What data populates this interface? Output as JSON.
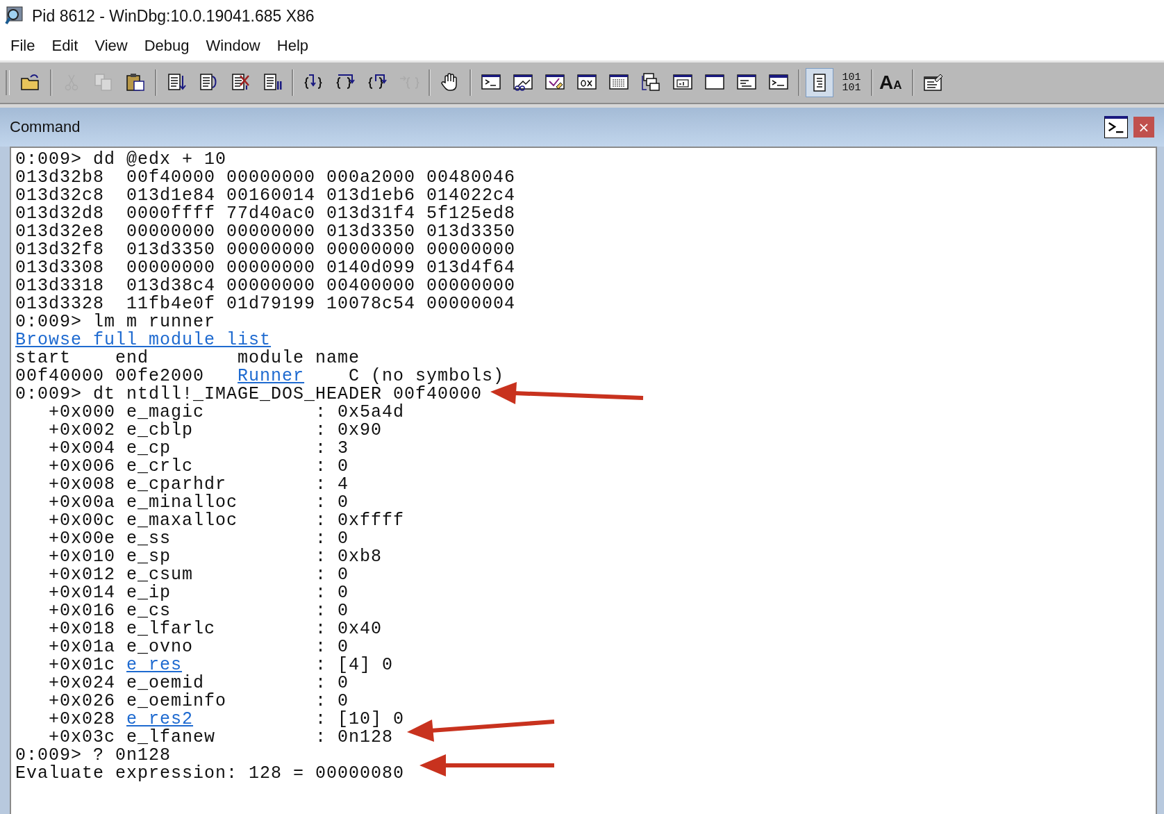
{
  "window": {
    "title": "Pid 8612 - WinDbg:10.0.19041.685 X86"
  },
  "menu": [
    "File",
    "Edit",
    "View",
    "Debug",
    "Window",
    "Help"
  ],
  "toolbar": [
    [
      {
        "kind": "open",
        "disabled": false,
        "selected": false
      }
    ],
    [
      {
        "kind": "cut",
        "disabled": true,
        "selected": false
      },
      {
        "kind": "copy",
        "disabled": true,
        "selected": false
      },
      {
        "kind": "paste",
        "disabled": false,
        "selected": false
      }
    ],
    [
      {
        "kind": "go",
        "disabled": false,
        "selected": false
      },
      {
        "kind": "restart",
        "disabled": false,
        "selected": false
      },
      {
        "kind": "stop",
        "disabled": false,
        "selected": false
      },
      {
        "kind": "break",
        "disabled": false,
        "selected": false
      }
    ],
    [
      {
        "kind": "step-into",
        "disabled": false,
        "selected": false
      },
      {
        "kind": "step-over",
        "disabled": false,
        "selected": false
      },
      {
        "kind": "step-out",
        "disabled": false,
        "selected": false
      },
      {
        "kind": "run-to-cursor",
        "disabled": true,
        "selected": false
      }
    ],
    [
      {
        "kind": "hand",
        "disabled": false,
        "selected": false
      }
    ],
    [
      {
        "kind": "command",
        "disabled": false,
        "selected": false
      },
      {
        "kind": "watch",
        "disabled": false,
        "selected": false
      },
      {
        "kind": "locals",
        "disabled": false,
        "selected": false
      },
      {
        "kind": "registers",
        "disabled": false,
        "selected": false
      },
      {
        "kind": "memory",
        "disabled": false,
        "selected": false
      },
      {
        "kind": "calls",
        "disabled": false,
        "selected": false
      },
      {
        "kind": "disasm",
        "disabled": false,
        "selected": false
      },
      {
        "kind": "scratch",
        "disabled": false,
        "selected": false
      },
      {
        "kind": "processes",
        "disabled": false,
        "selected": false
      },
      {
        "kind": "cmd-browser",
        "disabled": false,
        "selected": false
      }
    ],
    [
      {
        "kind": "source",
        "disabled": false,
        "selected": true
      },
      {
        "kind": "hex",
        "disabled": false,
        "selected": false,
        "text": "101\n101"
      }
    ],
    [
      {
        "kind": "font",
        "disabled": false,
        "selected": false,
        "letters": [
          "A",
          "A"
        ]
      }
    ],
    [
      {
        "kind": "options",
        "disabled": false,
        "selected": false
      }
    ]
  ],
  "panel": {
    "title": "Command",
    "close": "×"
  },
  "lines": [
    {
      "parts": [
        {
          "text": "0:009> dd @edx + 10",
          "link": false
        }
      ]
    },
    {
      "parts": [
        {
          "text": "013d32b8  00f40000 00000000 000a2000 00480046",
          "link": false
        }
      ]
    },
    {
      "parts": [
        {
          "text": "013d32c8  013d1e84 00160014 013d1eb6 014022c4",
          "link": false
        }
      ]
    },
    {
      "parts": [
        {
          "text": "013d32d8  0000ffff 77d40ac0 013d31f4 5f125ed8",
          "link": false
        }
      ]
    },
    {
      "parts": [
        {
          "text": "013d32e8  00000000 00000000 013d3350 013d3350",
          "link": false
        }
      ]
    },
    {
      "parts": [
        {
          "text": "013d32f8  013d3350 00000000 00000000 00000000",
          "link": false
        }
      ]
    },
    {
      "parts": [
        {
          "text": "013d3308  00000000 00000000 0140d099 013d4f64",
          "link": false
        }
      ]
    },
    {
      "parts": [
        {
          "text": "013d3318  013d38c4 00000000 00400000 00000000",
          "link": false
        }
      ]
    },
    {
      "parts": [
        {
          "text": "013d3328  11fb4e0f 01d79199 10078c54 00000004",
          "link": false
        }
      ]
    },
    {
      "parts": [
        {
          "text": "0:009> lm m runner",
          "link": false
        }
      ]
    },
    {
      "parts": [
        {
          "text": "Browse full module list",
          "link": true
        }
      ]
    },
    {
      "parts": [
        {
          "text": "start    end        module name",
          "link": false
        }
      ]
    },
    {
      "parts": [
        {
          "text": "00f40000 00fe2000   ",
          "link": false
        },
        {
          "text": "Runner",
          "link": true
        },
        {
          "text": "    C (no symbols)",
          "link": false
        }
      ]
    },
    {
      "parts": [
        {
          "text": "0:009> dt ntdll!_IMAGE_DOS_HEADER 00f40000",
          "link": false
        }
      ]
    },
    {
      "parts": [
        {
          "text": "   +0x000 e_magic          : 0x5a4d",
          "link": false
        }
      ]
    },
    {
      "parts": [
        {
          "text": "   +0x002 e_cblp           : 0x90",
          "link": false
        }
      ]
    },
    {
      "parts": [
        {
          "text": "   +0x004 e_cp             : 3",
          "link": false
        }
      ]
    },
    {
      "parts": [
        {
          "text": "   +0x006 e_crlc           : 0",
          "link": false
        }
      ]
    },
    {
      "parts": [
        {
          "text": "   +0x008 e_cparhdr        : 4",
          "link": false
        }
      ]
    },
    {
      "parts": [
        {
          "text": "   +0x00a e_minalloc       : 0",
          "link": false
        }
      ]
    },
    {
      "parts": [
        {
          "text": "   +0x00c e_maxalloc       : 0xffff",
          "link": false
        }
      ]
    },
    {
      "parts": [
        {
          "text": "   +0x00e e_ss             : 0",
          "link": false
        }
      ]
    },
    {
      "parts": [
        {
          "text": "   +0x010 e_sp             : 0xb8",
          "link": false
        }
      ]
    },
    {
      "parts": [
        {
          "text": "   +0x012 e_csum           : 0",
          "link": false
        }
      ]
    },
    {
      "parts": [
        {
          "text": "   +0x014 e_ip             : 0",
          "link": false
        }
      ]
    },
    {
      "parts": [
        {
          "text": "   +0x016 e_cs             : 0",
          "link": false
        }
      ]
    },
    {
      "parts": [
        {
          "text": "   +0x018 e_lfarlc         : 0x40",
          "link": false
        }
      ]
    },
    {
      "parts": [
        {
          "text": "   +0x01a e_ovno           : 0",
          "link": false
        }
      ]
    },
    {
      "parts": [
        {
          "text": "   +0x01c ",
          "link": false
        },
        {
          "text": "e_res",
          "link": true
        },
        {
          "text": "            : [4] 0",
          "link": false
        }
      ]
    },
    {
      "parts": [
        {
          "text": "   +0x024 e_oemid          : 0",
          "link": false
        }
      ]
    },
    {
      "parts": [
        {
          "text": "   +0x026 e_oeminfo        : 0",
          "link": false
        }
      ]
    },
    {
      "parts": [
        {
          "text": "   +0x028 ",
          "link": false
        },
        {
          "text": "e_res2",
          "link": true
        },
        {
          "text": "           : [10] 0",
          "link": false
        }
      ]
    },
    {
      "parts": [
        {
          "text": "   +0x03c e_lfanew         : 0n128",
          "link": false
        }
      ]
    },
    {
      "parts": [
        {
          "text": "0:009> ? 0n128",
          "link": false
        }
      ]
    },
    {
      "parts": [
        {
          "text": "Evaluate expression: 128 = 00000080",
          "link": false
        }
      ]
    }
  ]
}
